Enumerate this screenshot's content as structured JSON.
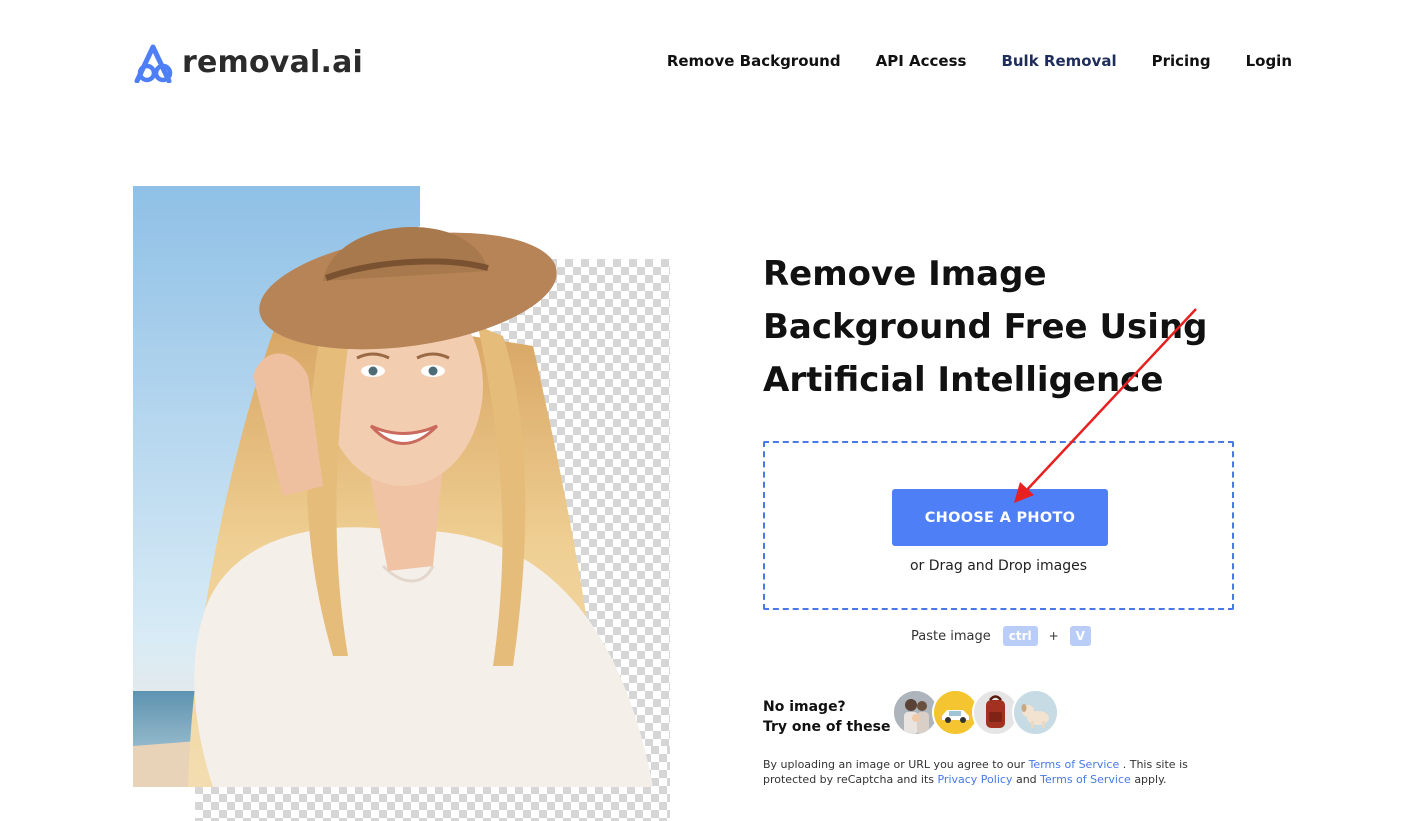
{
  "brand": {
    "name": "removal.ai",
    "accent": "#4f7ff7"
  },
  "nav": {
    "items": [
      {
        "label": "Remove Background"
      },
      {
        "label": "API Access"
      },
      {
        "label": "Bulk Removal"
      },
      {
        "label": "Pricing"
      },
      {
        "label": "Login"
      }
    ]
  },
  "hero": {
    "headline": "Remove Image Background Free Using Artificial Intelligence"
  },
  "upload": {
    "button_label": "CHOOSE A PHOTO",
    "drag_text": "or Drag and Drop images",
    "paste_label": "Paste image",
    "key1": "ctrl",
    "plus": "+",
    "key2": "V"
  },
  "samples": {
    "prompt_line1": "No image?",
    "prompt_line2": "Try one of these",
    "items": [
      "family-icon",
      "car-icon",
      "backpack-icon",
      "dog-icon"
    ]
  },
  "legal": {
    "part1": "By uploading an image or URL you agree to our",
    "tos1": "Terms of Service",
    "part2": ". This site is protected by reCaptcha and its",
    "privacy": "Privacy Policy",
    "part3": "and",
    "tos2": "Terms of Service",
    "part4": "apply."
  }
}
